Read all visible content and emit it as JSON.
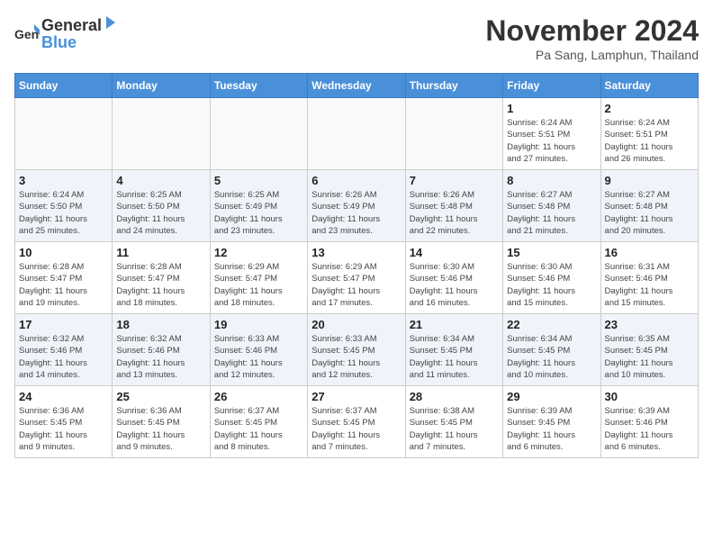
{
  "header": {
    "logo_line1": "General",
    "logo_line2": "Blue",
    "month": "November 2024",
    "location": "Pa Sang, Lamphun, Thailand"
  },
  "weekdays": [
    "Sunday",
    "Monday",
    "Tuesday",
    "Wednesday",
    "Thursday",
    "Friday",
    "Saturday"
  ],
  "weeks": [
    {
      "alt": false,
      "days": [
        {
          "num": "",
          "info": ""
        },
        {
          "num": "",
          "info": ""
        },
        {
          "num": "",
          "info": ""
        },
        {
          "num": "",
          "info": ""
        },
        {
          "num": "",
          "info": ""
        },
        {
          "num": "1",
          "info": "Sunrise: 6:24 AM\nSunset: 5:51 PM\nDaylight: 11 hours\nand 27 minutes."
        },
        {
          "num": "2",
          "info": "Sunrise: 6:24 AM\nSunset: 5:51 PM\nDaylight: 11 hours\nand 26 minutes."
        }
      ]
    },
    {
      "alt": true,
      "days": [
        {
          "num": "3",
          "info": "Sunrise: 6:24 AM\nSunset: 5:50 PM\nDaylight: 11 hours\nand 25 minutes."
        },
        {
          "num": "4",
          "info": "Sunrise: 6:25 AM\nSunset: 5:50 PM\nDaylight: 11 hours\nand 24 minutes."
        },
        {
          "num": "5",
          "info": "Sunrise: 6:25 AM\nSunset: 5:49 PM\nDaylight: 11 hours\nand 23 minutes."
        },
        {
          "num": "6",
          "info": "Sunrise: 6:26 AM\nSunset: 5:49 PM\nDaylight: 11 hours\nand 23 minutes."
        },
        {
          "num": "7",
          "info": "Sunrise: 6:26 AM\nSunset: 5:48 PM\nDaylight: 11 hours\nand 22 minutes."
        },
        {
          "num": "8",
          "info": "Sunrise: 6:27 AM\nSunset: 5:48 PM\nDaylight: 11 hours\nand 21 minutes."
        },
        {
          "num": "9",
          "info": "Sunrise: 6:27 AM\nSunset: 5:48 PM\nDaylight: 11 hours\nand 20 minutes."
        }
      ]
    },
    {
      "alt": false,
      "days": [
        {
          "num": "10",
          "info": "Sunrise: 6:28 AM\nSunset: 5:47 PM\nDaylight: 11 hours\nand 19 minutes."
        },
        {
          "num": "11",
          "info": "Sunrise: 6:28 AM\nSunset: 5:47 PM\nDaylight: 11 hours\nand 18 minutes."
        },
        {
          "num": "12",
          "info": "Sunrise: 6:29 AM\nSunset: 5:47 PM\nDaylight: 11 hours\nand 18 minutes."
        },
        {
          "num": "13",
          "info": "Sunrise: 6:29 AM\nSunset: 5:47 PM\nDaylight: 11 hours\nand 17 minutes."
        },
        {
          "num": "14",
          "info": "Sunrise: 6:30 AM\nSunset: 5:46 PM\nDaylight: 11 hours\nand 16 minutes."
        },
        {
          "num": "15",
          "info": "Sunrise: 6:30 AM\nSunset: 5:46 PM\nDaylight: 11 hours\nand 15 minutes."
        },
        {
          "num": "16",
          "info": "Sunrise: 6:31 AM\nSunset: 5:46 PM\nDaylight: 11 hours\nand 15 minutes."
        }
      ]
    },
    {
      "alt": true,
      "days": [
        {
          "num": "17",
          "info": "Sunrise: 6:32 AM\nSunset: 5:46 PM\nDaylight: 11 hours\nand 14 minutes."
        },
        {
          "num": "18",
          "info": "Sunrise: 6:32 AM\nSunset: 5:46 PM\nDaylight: 11 hours\nand 13 minutes."
        },
        {
          "num": "19",
          "info": "Sunrise: 6:33 AM\nSunset: 5:46 PM\nDaylight: 11 hours\nand 12 minutes."
        },
        {
          "num": "20",
          "info": "Sunrise: 6:33 AM\nSunset: 5:45 PM\nDaylight: 11 hours\nand 12 minutes."
        },
        {
          "num": "21",
          "info": "Sunrise: 6:34 AM\nSunset: 5:45 PM\nDaylight: 11 hours\nand 11 minutes."
        },
        {
          "num": "22",
          "info": "Sunrise: 6:34 AM\nSunset: 5:45 PM\nDaylight: 11 hours\nand 10 minutes."
        },
        {
          "num": "23",
          "info": "Sunrise: 6:35 AM\nSunset: 5:45 PM\nDaylight: 11 hours\nand 10 minutes."
        }
      ]
    },
    {
      "alt": false,
      "days": [
        {
          "num": "24",
          "info": "Sunrise: 6:36 AM\nSunset: 5:45 PM\nDaylight: 11 hours\nand 9 minutes."
        },
        {
          "num": "25",
          "info": "Sunrise: 6:36 AM\nSunset: 5:45 PM\nDaylight: 11 hours\nand 9 minutes."
        },
        {
          "num": "26",
          "info": "Sunrise: 6:37 AM\nSunset: 5:45 PM\nDaylight: 11 hours\nand 8 minutes."
        },
        {
          "num": "27",
          "info": "Sunrise: 6:37 AM\nSunset: 5:45 PM\nDaylight: 11 hours\nand 7 minutes."
        },
        {
          "num": "28",
          "info": "Sunrise: 6:38 AM\nSunset: 5:45 PM\nDaylight: 11 hours\nand 7 minutes."
        },
        {
          "num": "29",
          "info": "Sunrise: 6:39 AM\nSunset: 9:45 PM\nDaylight: 11 hours\nand 6 minutes."
        },
        {
          "num": "30",
          "info": "Sunrise: 6:39 AM\nSunset: 5:46 PM\nDaylight: 11 hours\nand 6 minutes."
        }
      ]
    }
  ]
}
